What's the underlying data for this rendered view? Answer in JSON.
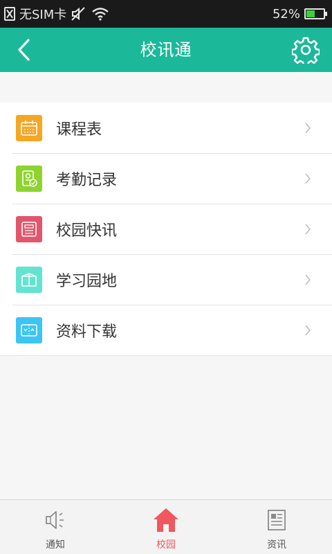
{
  "status_bar": {
    "carrier": "无SIM卡",
    "battery_percent": "52%",
    "battery_level": 0.52
  },
  "header": {
    "title": "校讯通"
  },
  "menu": {
    "items": [
      {
        "label": "课程表",
        "icon": "calendar-icon",
        "color": "#f5a623"
      },
      {
        "label": "考勤记录",
        "icon": "attendance-icon",
        "color": "#8ed330"
      },
      {
        "label": "校园快讯",
        "icon": "news-icon",
        "color": "#e0576d"
      },
      {
        "label": "学习园地",
        "icon": "book-icon",
        "color": "#63e3d1"
      },
      {
        "label": "资料下载",
        "icon": "download-icon",
        "color": "#3cc4f4"
      }
    ]
  },
  "tabs": [
    {
      "label": "通知",
      "icon": "speaker-icon"
    },
    {
      "label": "校园",
      "icon": "home-icon",
      "active": true
    },
    {
      "label": "资讯",
      "icon": "newspaper-icon"
    }
  ],
  "colors": {
    "header": "#1bb99a",
    "active_tab": "#f0575f"
  }
}
